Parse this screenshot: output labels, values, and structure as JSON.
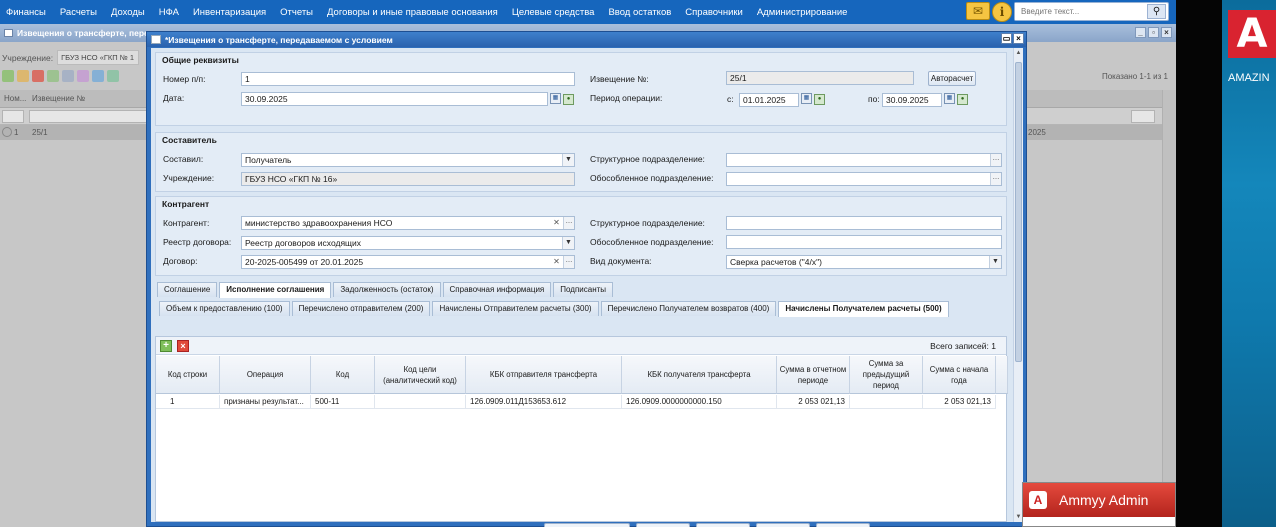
{
  "menu": [
    "Финансы",
    "Расчеты",
    "Доходы",
    "НФА",
    "Инвентаризация",
    "Отчеты",
    "Договоры и иные правовые основания",
    "Целевые средства",
    "Ввод остатков",
    "Справочники",
    "Администрирование"
  ],
  "top_search": {
    "placeholder": "Введите текст..."
  },
  "background_window": {
    "title": "Извещения о трансферте, перед",
    "institution_label": "Учреждение:",
    "institution_value": "ГБУЗ НСО «ГКП № 1",
    "shown": "Показано 1-1 из 1",
    "col_num": "Ном...",
    "col_notice": "Извещение №",
    "row_num": "1",
    "row_notice": "25/1",
    "row_date_fragment": "2025"
  },
  "dialog": {
    "title": "*Извещения о трансферте, передаваемом с условием",
    "general": {
      "section_title": "Общие реквизиты",
      "num_label": "Номер п/п:",
      "num_value": "1",
      "date_label": "Дата:",
      "date_value": "30.09.2025",
      "notice_label": "Извещение №:",
      "notice_value": "25/1",
      "autocalc_label": "Авторасчет",
      "period_label": "Период операции:",
      "from_label": "с:",
      "from_value": "01.01.2025",
      "to_label": "по:",
      "to_value": "30.09.2025"
    },
    "author": {
      "section_title": "Составитель",
      "composed_label": "Составил:",
      "composed_value": "Получатель",
      "institution_label": "Учреждение:",
      "institution_value": "ГБУЗ НСО «ГКП № 16»",
      "struct_label": "Структурное подразделение:",
      "separate_label": "Обособленное подразделение:"
    },
    "counterparty": {
      "section_title": "Контрагент",
      "cp_label": "Контрагент:",
      "cp_value": "министерство здравоохранения НСО",
      "registry_label": "Реестр договора:",
      "registry_value": "Реестр договоров исходящих",
      "contract_label": "Договор:",
      "contract_value": "20-2025-005499 от 20.01.2025",
      "struct_label": "Структурное подразделение:",
      "separate_label": "Обособленное подразделение:",
      "doctype_label": "Вид документа:",
      "doctype_value": "Сверка расчетов (\"4/х\")"
    },
    "tabs": [
      "Соглашение",
      "Исполнение соглашения",
      "Задолженность (остаток)",
      "Справочная информация",
      "Подписанты"
    ],
    "subtabs": [
      "Объем к предоставлению (100)",
      "Перечислено отправителем (200)",
      "Начислены Отправителем расчеты (300)",
      "Перечислено Получателем возвратов (400)",
      "Начислены Получателем расчеты (500)"
    ],
    "grid": {
      "total_label": "Всего записей:",
      "total_value": "1",
      "columns": [
        "Код строки",
        "Операция",
        "Код",
        "Код цели (аналитический код)",
        "КБК отправителя трансферта",
        "КБК получателя трансферта",
        "Сумма в отчетном периоде",
        "Сумма за предыдущий период",
        "Сумма с начала года"
      ],
      "rows": [
        [
          "1",
          "признаны результат...",
          "500-11",
          "",
          "126.0909.011Д153653.612",
          "126.0909.0000000000.150",
          "2 053 021,13",
          "",
          "2 053 021,13"
        ]
      ]
    }
  },
  "side": {
    "amazing_label": "AMAZIN",
    "ammyy_title": "Ammyy Admin"
  }
}
